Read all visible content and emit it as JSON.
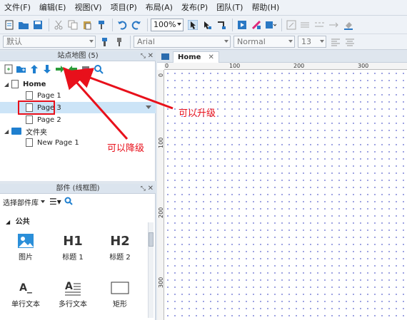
{
  "menu": [
    "文件(F)",
    "编辑(E)",
    "视图(V)",
    "项目(P)",
    "布局(A)",
    "发布(P)",
    "团队(T)",
    "帮助(H)"
  ],
  "toolbar": {
    "zoom": "100%",
    "style": "默认",
    "font": "Arial",
    "weight": "Normal",
    "size": "13"
  },
  "sitemap": {
    "title": "站点地图 (5)",
    "tree": [
      {
        "label": "Home",
        "level": 0,
        "type": "page",
        "expanded": true
      },
      {
        "label": "Page 1",
        "level": 1,
        "type": "page"
      },
      {
        "label": "Page 3",
        "level": 1,
        "type": "page",
        "selected": true
      },
      {
        "label": "Page 2",
        "level": 1,
        "type": "page"
      },
      {
        "label": "文件夹",
        "level": 0,
        "type": "folder",
        "expanded": true
      },
      {
        "label": "New Page 1",
        "level": 1,
        "type": "page"
      }
    ]
  },
  "widgets": {
    "title": "部件 (线框图)",
    "library": "选择部件库",
    "category": "公共",
    "items": [
      {
        "glyph": "",
        "label": "图片",
        "icon": "image-icon"
      },
      {
        "glyph": "H1",
        "label": "标题 1",
        "icon": "heading1-icon"
      },
      {
        "glyph": "H2",
        "label": "标题 2",
        "icon": "heading2-icon"
      },
      {
        "glyph": "A_",
        "label": "单行文本",
        "icon": "text-field-icon"
      },
      {
        "glyph": "",
        "label": "多行文本",
        "icon": "paragraph-icon"
      },
      {
        "glyph": "",
        "label": "矩形",
        "icon": "rectangle-icon"
      }
    ]
  },
  "canvas": {
    "tab": "Home",
    "ruler_h": [
      "0",
      "100",
      "200",
      "300"
    ],
    "ruler_v": [
      "0",
      "100",
      "200",
      "300"
    ]
  },
  "annotations": {
    "promote": "可以升级",
    "demote": "可以降级"
  },
  "colors": {
    "accent": "#1f7fcf",
    "annotation": "#e8101b",
    "selected_row": "#cce4f7"
  }
}
